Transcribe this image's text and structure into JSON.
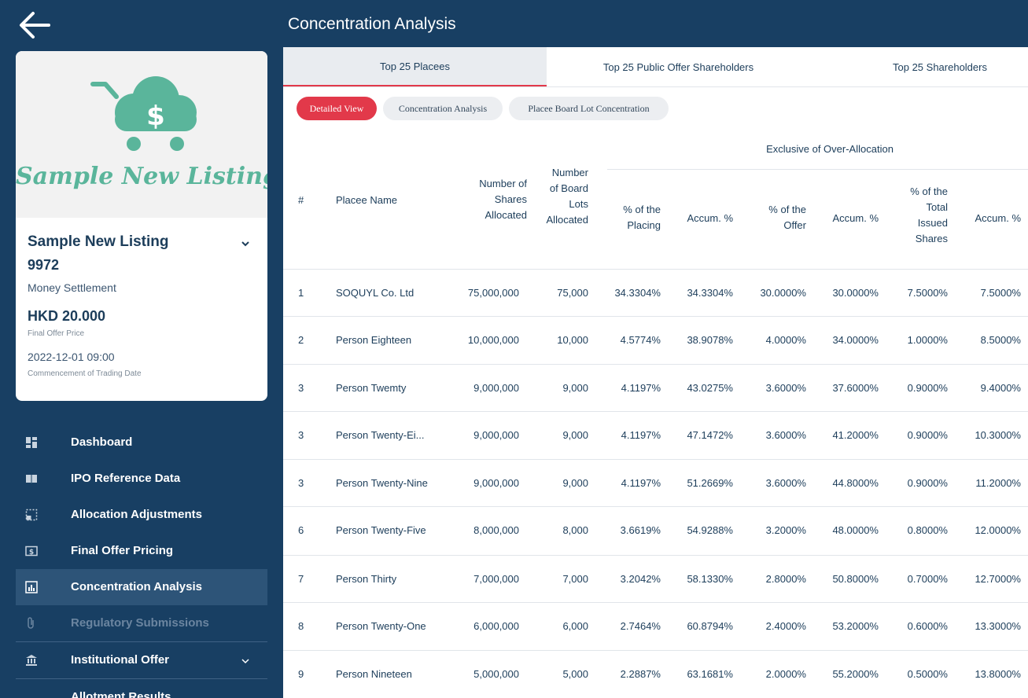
{
  "header": {
    "title": "Concentration Analysis"
  },
  "listing": {
    "logo_text": "Sample New Listing",
    "name": "Sample New Listing",
    "code": "9972",
    "settlement": "Money Settlement",
    "price": "HKD 20.000",
    "price_label": "Final Offer Price",
    "trading_date": "2022-12-01 09:00",
    "trading_date_label": "Commencement of Trading Date"
  },
  "nav": {
    "items": [
      {
        "label": "Dashboard",
        "icon": "dashboard-icon"
      },
      {
        "label": "IPO Reference Data",
        "icon": "book-icon"
      },
      {
        "label": "Allocation Adjustments",
        "icon": "adjustment-icon"
      },
      {
        "label": "Final Offer Pricing",
        "icon": "dollar-icon"
      },
      {
        "label": "Concentration Analysis",
        "icon": "chart-icon",
        "active": true
      },
      {
        "label": "Regulatory Submissions",
        "icon": "paperclip-icon",
        "disabled": true
      },
      {
        "label": "Institutional Offer",
        "icon": "bank-icon",
        "expandable": true
      },
      {
        "label": "Allotment Results",
        "icon": "results-icon"
      }
    ]
  },
  "tabs": [
    "Top 25 Placees",
    "Top 25 Public Offer Shareholders",
    "Top 25 Shareholders"
  ],
  "subtabs": [
    "Detailed View",
    "Concentration Analysis",
    "Placee Board Lot Concentration"
  ],
  "table": {
    "group_header": "Exclusive of Over-Allocation",
    "columns": {
      "num": "#",
      "name": "Placee Name",
      "shares": [
        "Number of",
        "Shares",
        "Allocated"
      ],
      "lots": [
        "Number",
        "of Board",
        "Lots",
        "Allocated"
      ],
      "pct_placing": [
        "% of the",
        "Placing"
      ],
      "accum1": "Accum. %",
      "pct_offer": [
        "% of the",
        "Offer"
      ],
      "accum2": "Accum. %",
      "pct_total": [
        "% of the",
        "Total",
        "Issued",
        "Shares"
      ],
      "accum3": "Accum. %"
    },
    "rows": [
      [
        "1",
        "SOQUYL Co. Ltd",
        "75,000,000",
        "75,000",
        "34.3304%",
        "34.3304%",
        "30.0000%",
        "30.0000%",
        "7.5000%",
        "7.5000%"
      ],
      [
        "2",
        "Person Eighteen",
        "10,000,000",
        "10,000",
        "4.5774%",
        "38.9078%",
        "4.0000%",
        "34.0000%",
        "1.0000%",
        "8.5000%"
      ],
      [
        "3",
        "Person Twemty",
        "9,000,000",
        "9,000",
        "4.1197%",
        "43.0275%",
        "3.6000%",
        "37.6000%",
        "0.9000%",
        "9.4000%"
      ],
      [
        "3",
        "Person Twenty-Ei...",
        "9,000,000",
        "9,000",
        "4.1197%",
        "47.1472%",
        "3.6000%",
        "41.2000%",
        "0.9000%",
        "10.3000%"
      ],
      [
        "3",
        "Person Twenty-Nine",
        "9,000,000",
        "9,000",
        "4.1197%",
        "51.2669%",
        "3.6000%",
        "44.8000%",
        "0.9000%",
        "11.2000%"
      ],
      [
        "6",
        "Person Twenty-Five",
        "8,000,000",
        "8,000",
        "3.6619%",
        "54.9288%",
        "3.2000%",
        "48.0000%",
        "0.8000%",
        "12.0000%"
      ],
      [
        "7",
        "Person Thirty",
        "7,000,000",
        "7,000",
        "3.2042%",
        "58.1330%",
        "2.8000%",
        "50.8000%",
        "0.7000%",
        "12.7000%"
      ],
      [
        "8",
        "Person Twenty-One",
        "6,000,000",
        "6,000",
        "2.7464%",
        "60.8794%",
        "2.4000%",
        "53.2000%",
        "0.6000%",
        "13.3000%"
      ],
      [
        "9",
        "Person Nineteen",
        "5,000,000",
        "5,000",
        "2.2887%",
        "63.1681%",
        "2.0000%",
        "55.2000%",
        "0.5000%",
        "13.8000%"
      ]
    ]
  },
  "colors": {
    "navy": "#183f63",
    "accent_red": "#e2394a",
    "logo_green": "#5ab59b"
  }
}
